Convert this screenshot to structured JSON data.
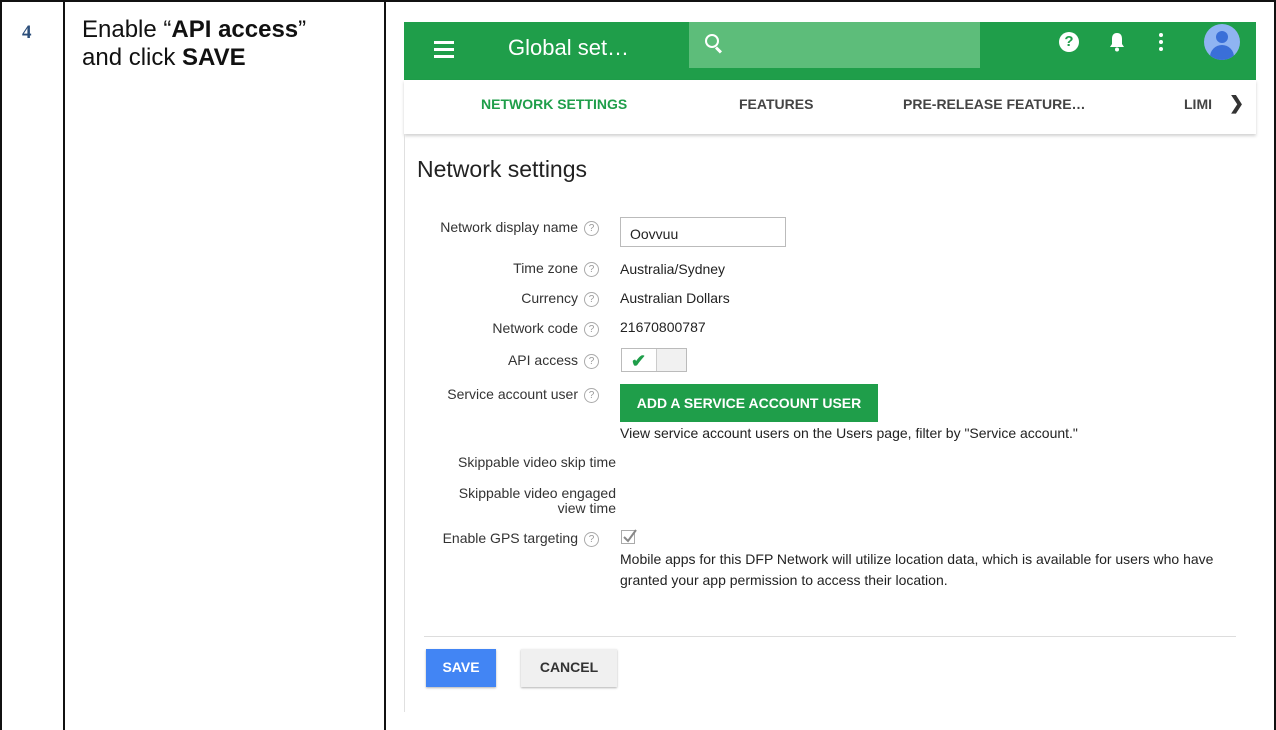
{
  "instruction": {
    "step_number": "4",
    "line1_prefix": "Enable “",
    "line1_bold": "API access",
    "line1_suffix": "”",
    "line2_prefix": "and click ",
    "line2_bold": "SAVE"
  },
  "app": {
    "colors": {
      "brand_green": "#1f9e4a",
      "save_blue": "#4285f4"
    },
    "header": {
      "title": "Global set…",
      "icons": [
        "menu-icon",
        "search-icon",
        "help-icon",
        "notifications-icon",
        "more-vert-icon",
        "account-avatar"
      ]
    },
    "tabs": [
      {
        "label": "NETWORK SETTINGS",
        "active": true
      },
      {
        "label": "FEATURES",
        "active": false
      },
      {
        "label": "PRE-RELEASE FEATURE…",
        "active": false
      },
      {
        "label": "LIMI",
        "active": false
      }
    ],
    "page_title": "Network settings",
    "fields": {
      "network_display_name": {
        "label": "Network display name",
        "value": "Oovvuu"
      },
      "time_zone": {
        "label": "Time zone",
        "value": "Australia/Sydney"
      },
      "currency": {
        "label": "Currency",
        "value": "Australian Dollars"
      },
      "network_code": {
        "label": "Network code",
        "value": "21670800787"
      },
      "api_access": {
        "label": "API access",
        "enabled": true
      },
      "service_account_user": {
        "label": "Service account user",
        "button": "ADD A SERVICE ACCOUNT USER",
        "note": "View service account users on the Users page, filter by \"Service account.\""
      },
      "skip_time": {
        "label": "Skippable video skip time"
      },
      "engaged_view": {
        "label_line1": "Skippable video engaged",
        "label_line2": "view time"
      },
      "gps_targeting": {
        "label": "Enable GPS targeting",
        "checked": true,
        "note": "Mobile apps for this DFP Network will utilize location data, which is available for users who have granted your app permission to access their location."
      }
    },
    "actions": {
      "save": "SAVE",
      "cancel": "CANCEL"
    }
  }
}
